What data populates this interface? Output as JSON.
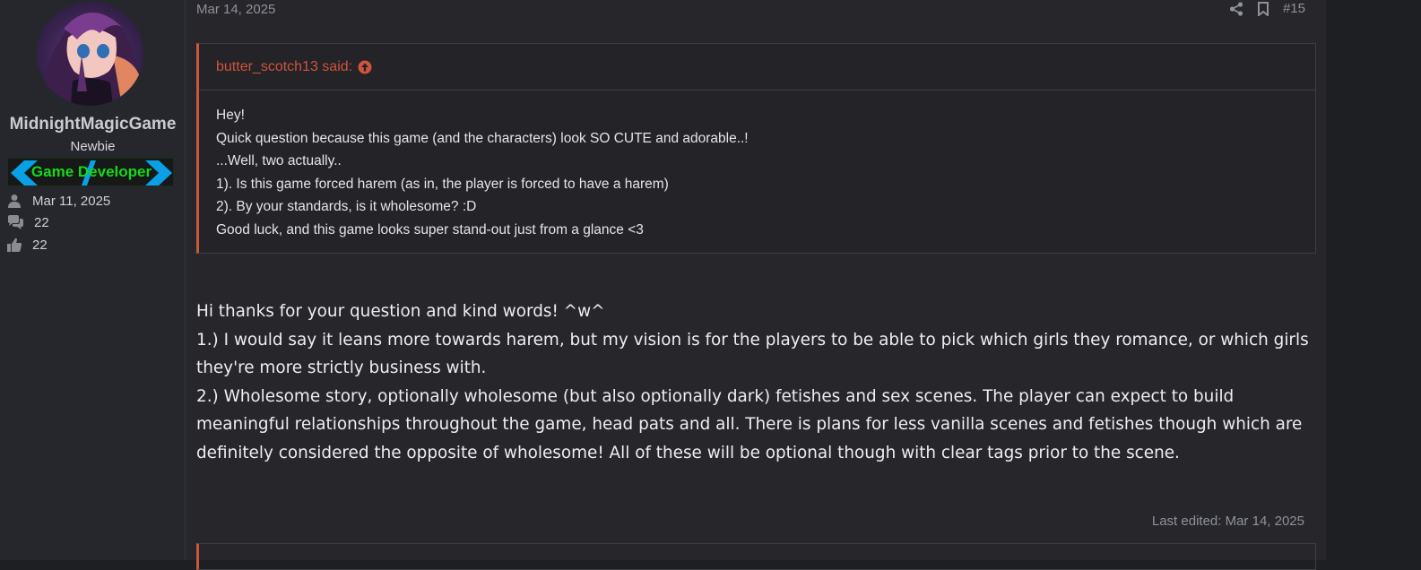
{
  "user": {
    "name": "MidnightMagicGame",
    "rank": "Newbie",
    "banner": "Game Developer",
    "joined": "Mar 11, 2025",
    "messages": "22",
    "reactions": "22"
  },
  "post": {
    "date": "Mar 14, 2025",
    "number": "#15",
    "quote": {
      "author_said": "butter_scotch13 said:",
      "lines": [
        "Hey!",
        "Quick question because this game (and the characters) look SO CUTE and adorable..!",
        "...Well, two actually..",
        "1). Is this game forced harem (as in, the player is forced to have a harem)",
        "2). By your standards, is it wholesome? :D",
        "Good luck, and this game looks super stand-out just from a glance <3"
      ]
    },
    "reply": [
      "Hi thanks for your question and kind words! ^w^",
      "1.) I would say it leans more towards harem, but my vision is for the players to be able to pick which girls they romance, or which girls they're more strictly business with.",
      "2.) Wholesome story, optionally wholesome (but also optionally dark) fetishes and sex scenes. The player can expect to build meaningful relationships throughout the game, head pats and all. There is plans for less vanilla scenes and fetishes though which are definitely considered the opposite of wholesome! All of these will be optional though with clear tags prior to the scene."
    ],
    "last_edited": "Last edited: Mar 14, 2025"
  },
  "colors": {
    "background": "#26262b",
    "accent": "#c9573d",
    "banner_text": "#14d91c",
    "banner_arrow": "#0aa0e6"
  },
  "icons": [
    "share-icon",
    "bookmark-icon",
    "arrow-up-circle-icon",
    "user-icon",
    "comments-icon",
    "thumbs-up-icon"
  ]
}
